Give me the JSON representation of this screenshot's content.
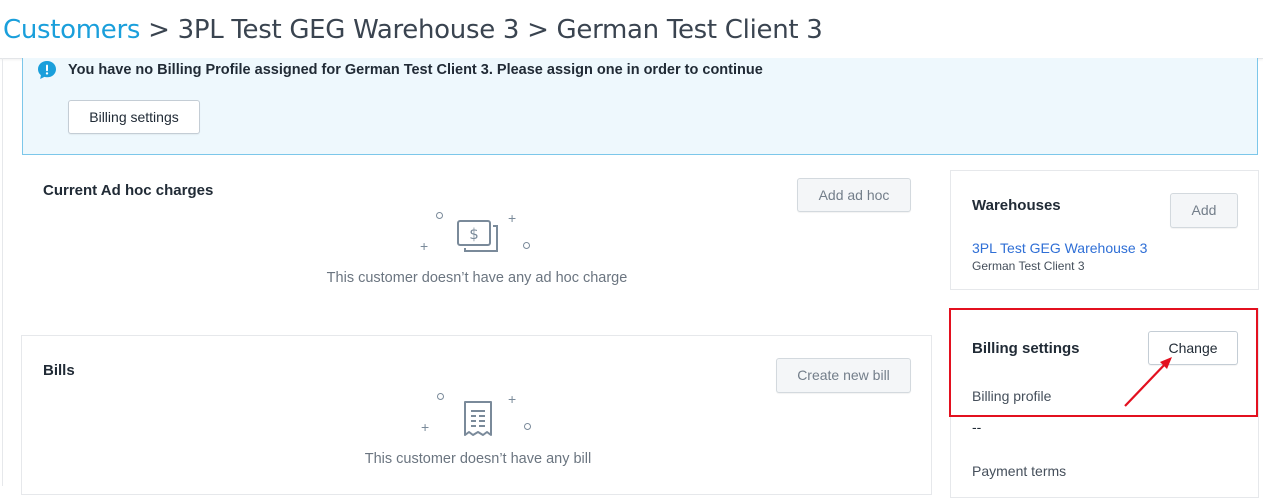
{
  "breadcrumb": {
    "root": "Customers",
    "separator": ">",
    "warehouse": "3PL Test GEG Warehouse 3",
    "client": "German Test Client 3"
  },
  "banner": {
    "icon": "info-speech-bubble-icon",
    "message": "You have no Billing Profile assigned for German Test Client 3. Please assign one in order to continue",
    "button_label": "Billing settings"
  },
  "adhoc": {
    "title": "Current Ad hoc charges",
    "button_label": "Add ad hoc",
    "empty_icon": "dollar-bills-icon",
    "empty_text": "This customer doesn’t have any ad hoc charge"
  },
  "bills": {
    "title": "Bills",
    "button_label": "Create new bill",
    "empty_icon": "receipt-icon",
    "empty_text": "This customer doesn’t have any bill"
  },
  "warehouses": {
    "title": "Warehouses",
    "button_label": "Add",
    "items": [
      {
        "name": "3PL Test GEG Warehouse 3",
        "client": "German Test Client 3"
      }
    ]
  },
  "billing_settings": {
    "title": "Billing settings",
    "button_label": "Change",
    "profile_label": "Billing profile",
    "profile_value": "--",
    "payment_terms_label": "Payment terms"
  },
  "colors": {
    "accent": "#1a9fdb",
    "link": "#2f6fd6",
    "banner_bg": "#eef8fd",
    "highlight": "#e3101f"
  }
}
